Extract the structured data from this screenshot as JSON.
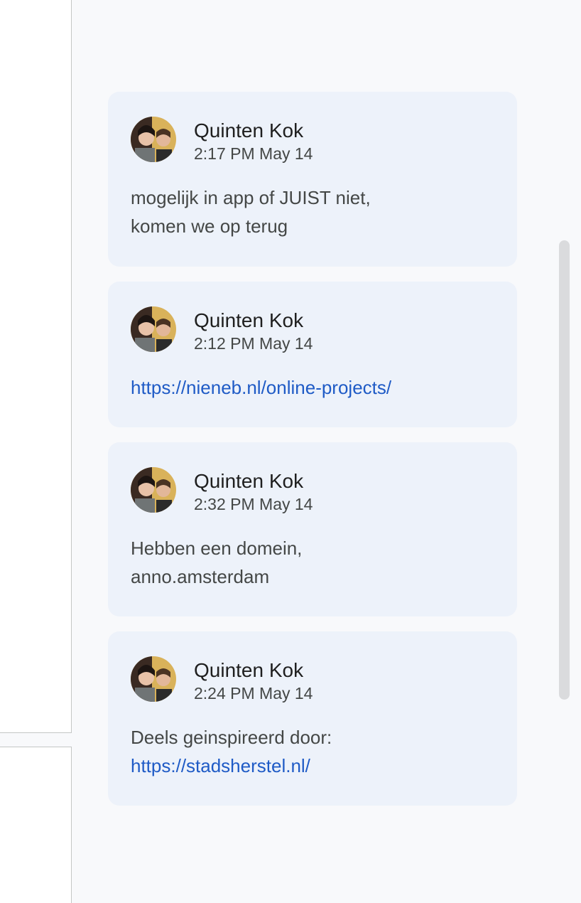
{
  "comments": [
    {
      "author": "Quinten Kok",
      "time": "2:17 PM May 14",
      "lines": [
        "mogelijk in app of JUIST niet,",
        "komen we op terug"
      ]
    },
    {
      "author": "Quinten Kok",
      "time": "2:12 PM May 14",
      "link": "https://nieneb.nl/online-projects/"
    },
    {
      "author": "Quinten Kok",
      "time": "2:32 PM May 14",
      "lines": [
        "Hebben een domein,",
        "anno.amsterdam"
      ]
    },
    {
      "author": "Quinten Kok",
      "time": "2:24 PM May 14",
      "lines": [
        "Deels geinspireerd door:"
      ],
      "link": "https://stadsherstel.nl/"
    }
  ],
  "colors": {
    "card_bg": "#edf2fa",
    "link": "#1f5bc6",
    "panel_bg": "#f8f9fb"
  },
  "icons": {
    "avatar": "user-photo-avatar"
  }
}
